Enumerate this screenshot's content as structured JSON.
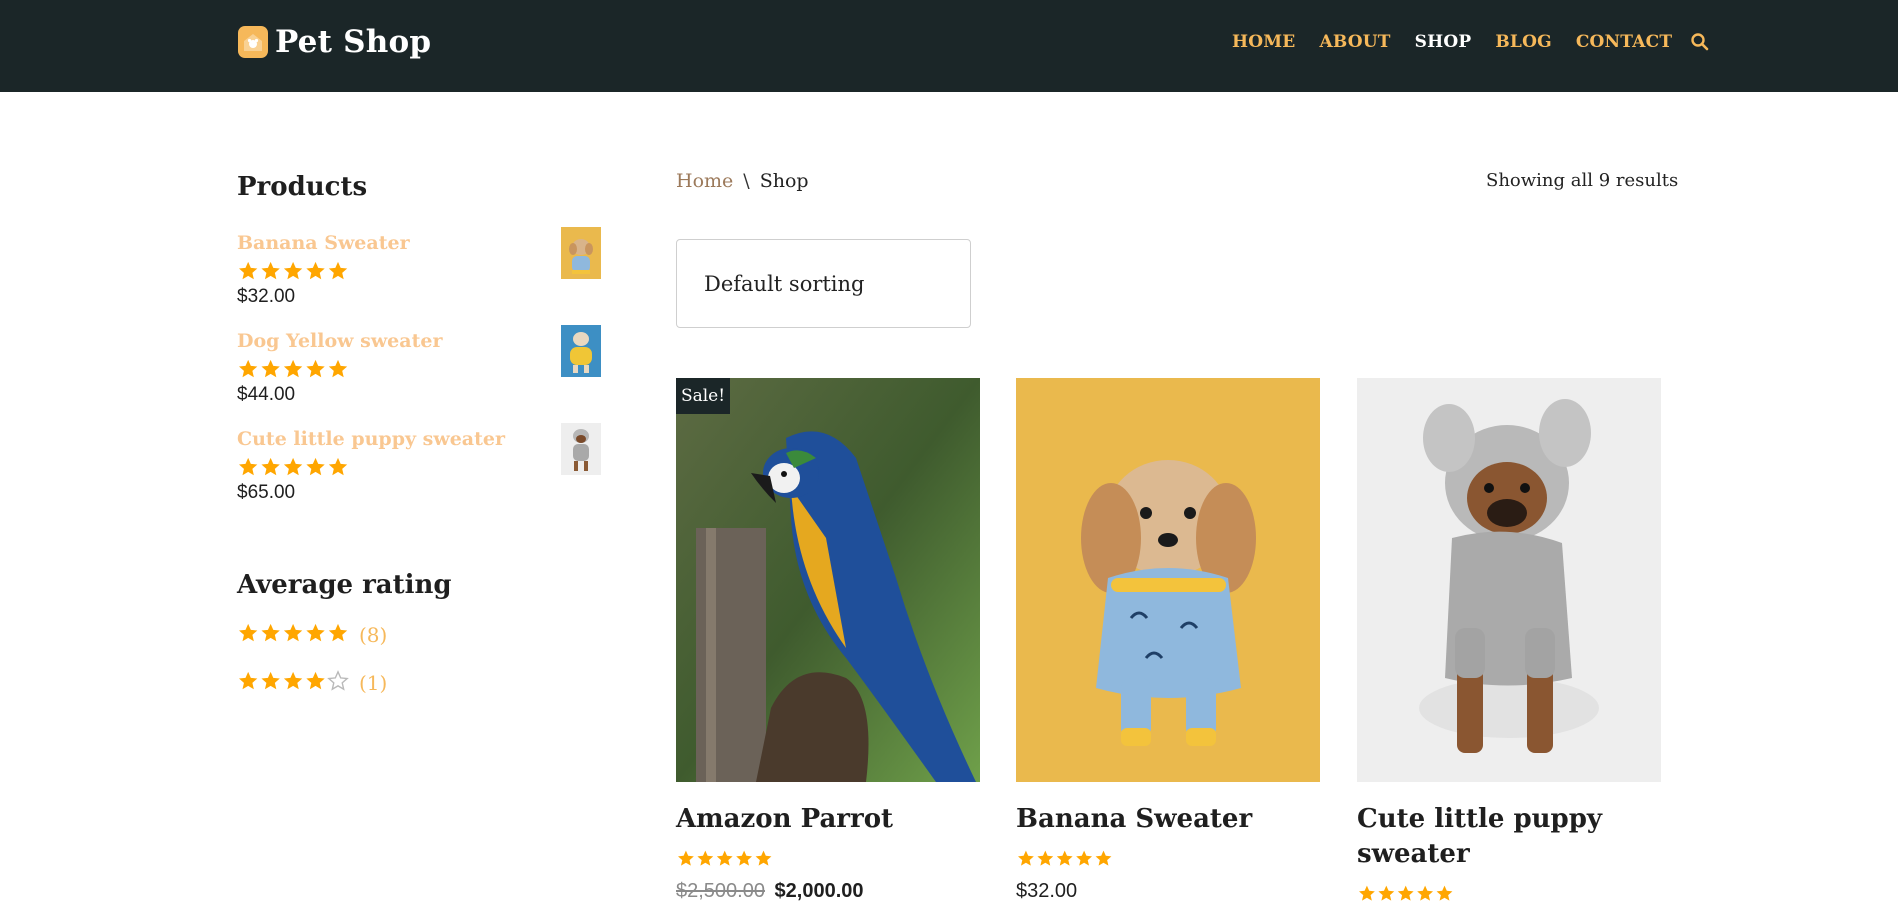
{
  "header": {
    "brand": "Pet Shop",
    "nav": [
      {
        "label": "HOME",
        "active": false
      },
      {
        "label": "ABOUT",
        "active": false
      },
      {
        "label": "SHOP",
        "active": true
      },
      {
        "label": "BLOG",
        "active": false
      },
      {
        "label": "CONTACT",
        "active": false
      }
    ],
    "search_icon": "search-icon"
  },
  "sidebar": {
    "products_title": "Products",
    "products": [
      {
        "name": "Banana Sweater",
        "price": "$32.00",
        "rating": 5
      },
      {
        "name": "Dog Yellow sweater",
        "price": "$44.00",
        "rating": 5
      },
      {
        "name": "Cute little puppy sweater",
        "price": "$65.00",
        "rating": 5
      }
    ],
    "rating_title": "Average rating",
    "ratings": [
      {
        "stars": 5,
        "count": "(8)"
      },
      {
        "stars": 4,
        "count": "(1)"
      }
    ]
  },
  "shop": {
    "breadcrumb": {
      "home": "Home",
      "separator": "\\",
      "current": "Shop"
    },
    "result_count": "Showing all 9 results",
    "sorting": "Default sorting",
    "products": [
      {
        "title": "Amazon Parrot",
        "rating": 5,
        "sale_badge": "Sale!",
        "old_price": "$2,500.00",
        "price": "$2,000.00"
      },
      {
        "title": "Banana Sweater",
        "rating": 5,
        "price": "$32.00"
      },
      {
        "title": "Cute little puppy sweater",
        "rating": 5
      }
    ]
  },
  "colors": {
    "header_bg": "#1b2628",
    "accent": "#f6b85a",
    "star": "#ffa600",
    "sidebar_link": "#f9c791"
  }
}
